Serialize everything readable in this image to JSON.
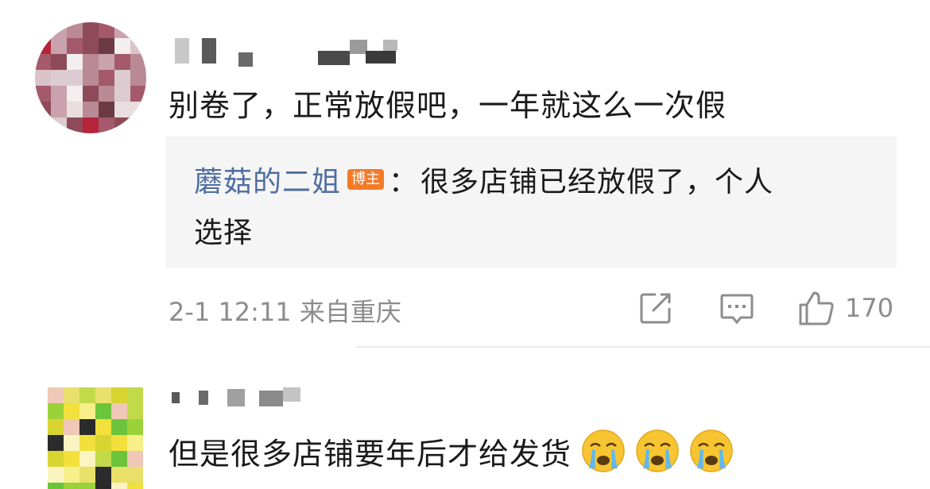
{
  "comments": [
    {
      "text": "别卷了，正常放假吧，一年就这么一次假",
      "reply": {
        "author": "蘑菇的二姐",
        "badge": "博主",
        "separator": "：",
        "content_line1": "很多店铺已经放假了，个人",
        "content_line2": "选择"
      },
      "meta": "2-1 12:11 来自重庆",
      "likes": "170",
      "icons": {
        "share": "share-icon",
        "comment": "comment-icon",
        "like": "thumbs-up-icon"
      }
    },
    {
      "text": "但是很多店铺要年后才给发货",
      "emojis": [
        "crying-emoji",
        "crying-emoji",
        "crying-emoji"
      ]
    }
  ],
  "colors": {
    "author": "#4e6ea1",
    "badge": "#f47a28",
    "meta": "#8c8c8c",
    "reply_bg": "#f5f5f5"
  }
}
